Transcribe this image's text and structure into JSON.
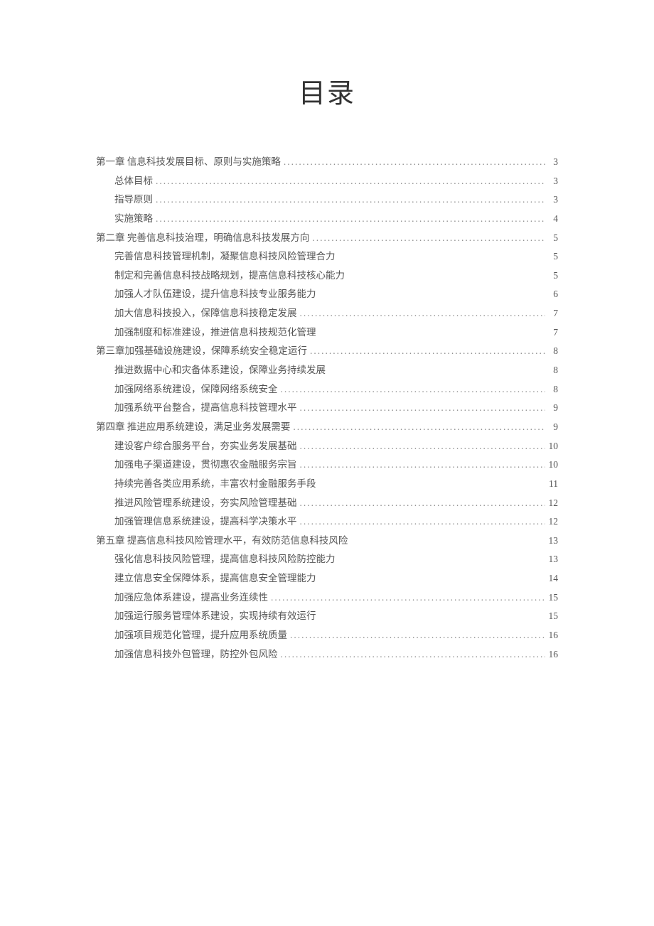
{
  "title": "目录",
  "entries": [
    {
      "level": 1,
      "text": "第一章 信息科技发展目标、原则与实施策略",
      "page": "3",
      "dots": true
    },
    {
      "level": 2,
      "text": "总体目标",
      "page": "3",
      "dots": true
    },
    {
      "level": 2,
      "text": "指导原则",
      "page": "3",
      "dots": true
    },
    {
      "level": 2,
      "text": "实施策略",
      "page": "4",
      "dots": true
    },
    {
      "level": 1,
      "text": "第二章 完善信息科技治理，明确信息科技发展方向",
      "page": "5",
      "dots": true
    },
    {
      "level": 2,
      "text": "完善信息科技管理机制，凝聚信息科技风险管理合力",
      "page": "5",
      "dots": false
    },
    {
      "level": 2,
      "text": "制定和完善信息科技战略规划，提高信息科技核心能力",
      "page": "5",
      "dots": false
    },
    {
      "level": 2,
      "text": "加强人才队伍建设，提升信息科技专业服务能力",
      "page": "6",
      "dots": false
    },
    {
      "level": 2,
      "text": "加大信息科技投入，保障信息科技稳定发展",
      "page": "7",
      "dots": true
    },
    {
      "level": 2,
      "text": "加强制度和标准建设，推进信息科技规范化管理",
      "page": "7",
      "dots": false
    },
    {
      "level": 1,
      "text": "第三章加强基础设施建设，保障系统安全稳定运行",
      "page": "8",
      "dots": true
    },
    {
      "level": 2,
      "text": "推进数据中心和灾备体系建设，保障业务持续发展",
      "page": "8",
      "dots": false
    },
    {
      "level": 2,
      "text": "加强网络系统建设，保障网络系统安全",
      "page": "8",
      "dots": true
    },
    {
      "level": 2,
      "text": "加强系统平台整合，提高信息科技管理水平",
      "page": "9",
      "dots": true
    },
    {
      "level": 1,
      "text": "第四章 推进应用系统建设，满足业务发展需要",
      "page": "9",
      "dots": true
    },
    {
      "level": 2,
      "text": "建设客户综合服务平台，夯实业务发展基础",
      "page": "10",
      "dots": true
    },
    {
      "level": 2,
      "text": "加强电子渠道建设，贯彻惠农金融服务宗旨",
      "page": "10",
      "dots": true
    },
    {
      "level": 2,
      "text": "持续完善各类应用系统，丰富农村金融服务手段",
      "page": "11",
      "dots": false
    },
    {
      "level": 2,
      "text": "推进风险管理系统建设，夯实风险管理基础",
      "page": "12",
      "dots": true
    },
    {
      "level": 2,
      "text": "加强管理信息系统建设，提高科学决策水平",
      "page": "12",
      "dots": true
    },
    {
      "level": 1,
      "text": "第五章 提高信息科技风险管理水平，有效防范信息科技风险",
      "page": "13",
      "dots": false
    },
    {
      "level": 2,
      "text": "强化信息科技风险管理，提高信息科技风险防控能力",
      "page": "13",
      "dots": false
    },
    {
      "level": 2,
      "text": "建立信息安全保障体系，提高信息安全管理能力",
      "page": "14",
      "dots": false
    },
    {
      "level": 2,
      "text": "加强应急体系建设，提高业务连续性",
      "page": "15",
      "dots": true
    },
    {
      "level": 2,
      "text": "加强运行服务管理体系建设，实现持续有效运行",
      "page": "15",
      "dots": false
    },
    {
      "level": 2,
      "text": "加强项目规范化管理，提升应用系统质量",
      "page": "16",
      "dots": true
    },
    {
      "level": 2,
      "text": "加强信息科技外包管理，防控外包风险",
      "page": "16",
      "dots": true
    }
  ]
}
